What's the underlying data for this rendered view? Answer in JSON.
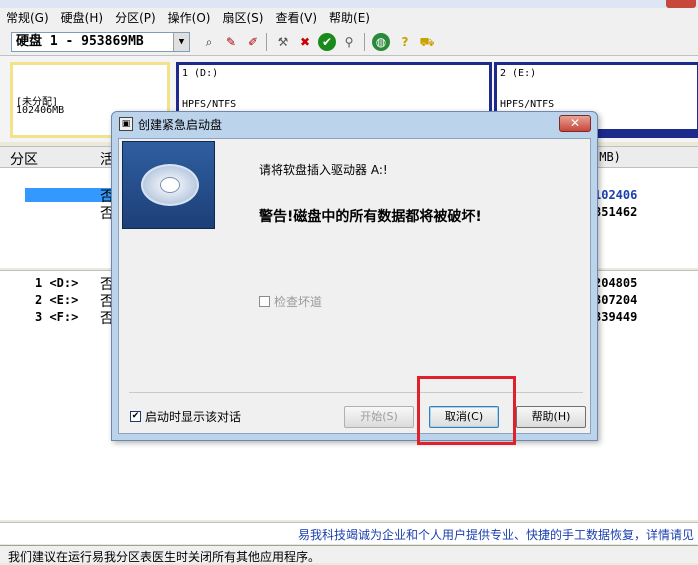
{
  "menubar": {
    "items": [
      "常规(G)",
      "硬盘(H)",
      "分区(P)",
      "操作(O)",
      "扇区(S)",
      "查看(V)",
      "帮助(E)"
    ]
  },
  "toolbar": {
    "disk_select_value": "硬盘 1 - 953869MB"
  },
  "disk_map": {
    "unallocated_label": "[未分配]",
    "unallocated_size": "102406MB",
    "partitions": [
      {
        "label": "1 (D:)",
        "fs": "HPFS/NTFS"
      },
      {
        "label": "2 (E:)",
        "fs": "HPFS/NTFS"
      }
    ]
  },
  "partition_list": {
    "col_partition": "分区",
    "col_active": "活",
    "col_size": "(MB)",
    "top_rows": [
      {
        "active": "否",
        "size": "102406"
      },
      {
        "active": "否",
        "size": "851462"
      }
    ],
    "rows": [
      {
        "name": "1 <D:>",
        "active": "否",
        "size": "204805"
      },
      {
        "name": "2 <E:>",
        "active": "否",
        "size": "307204"
      },
      {
        "name": "3 <F:>",
        "active": "否",
        "size": "339449"
      }
    ]
  },
  "info_strip": "易我科技竭诚为企业和个人用户提供专业、快捷的手工数据恢复，详情请见",
  "status_text": "我们建议在运行易我分区表医生时关闭所有其他应用程序。",
  "dialog": {
    "title": "创建紧急启动盘",
    "message": "请将软盘插入驱动器 A:!",
    "warning": "警告!磁盘中的所有数据都将被破坏!",
    "check_bad_label": "检查坏道",
    "show_on_start_label": "启动时显示该对话",
    "start_button": "开始(S)",
    "cancel_button": "取消(C)",
    "help_button": "帮助(H)"
  },
  "colors": {
    "highlight": "#e0202a",
    "partition_border": "#1c2a8c",
    "unallocated_border": "#f2e28a",
    "selection": "#3399ff",
    "info_text": "#1a3fae"
  }
}
